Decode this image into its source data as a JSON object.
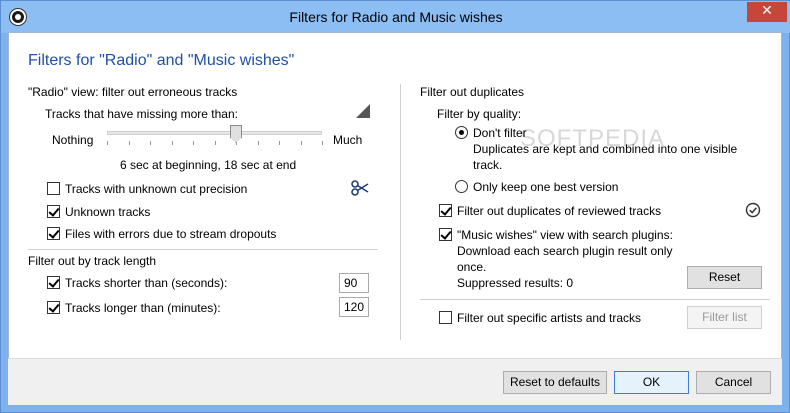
{
  "window": {
    "title": "Filters for Radio and Music wishes",
    "close_glyph": "✕"
  },
  "heading": "Filters for \"Radio\" and \"Music wishes\"",
  "left": {
    "radio_group_label": "\"Radio\" view: filter out erroneous tracks",
    "missing_label": "Tracks that have missing more than:",
    "slider": {
      "min_label": "Nothing",
      "max_label": "Much",
      "value_text": "6 sec at beginning, 18 sec at end",
      "position": 0.6
    },
    "checks": [
      {
        "label": "Tracks with unknown cut precision",
        "checked": false
      },
      {
        "label": "Unknown tracks",
        "checked": true
      },
      {
        "label": "Files with errors due to stream dropouts",
        "checked": true
      }
    ],
    "length_group_label": "Filter out by track length",
    "shorter": {
      "label": "Tracks shorter than (seconds):",
      "checked": true,
      "value": "90"
    },
    "longer": {
      "label": "Tracks longer than (minutes):",
      "checked": true,
      "value": "120"
    }
  },
  "right": {
    "dup_group_label": "Filter out duplicates",
    "quality_label": "Filter by quality:",
    "dont_filter": {
      "label": "Don't filter",
      "checked": true
    },
    "dont_filter_desc": "Duplicates are kept and combined into one visible track.",
    "keep_best": {
      "label": "Only keep one best version",
      "checked": false
    },
    "reviewed": {
      "label": "Filter out duplicates of reviewed tracks",
      "checked": true
    },
    "music_wishes": {
      "label": "\"Music wishes\" view with search plugins:",
      "checked": true
    },
    "music_wishes_desc": "Download each search plugin result only once.",
    "suppressed": "Suppressed results: 0",
    "reset_label": "Reset",
    "artists": {
      "label": "Filter out specific artists and tracks",
      "checked": false
    },
    "filter_list_label": "Filter list"
  },
  "footer": {
    "reset_defaults": "Reset to defaults",
    "ok": "OK",
    "cancel": "Cancel"
  },
  "watermark": "SOFTPEDIA"
}
